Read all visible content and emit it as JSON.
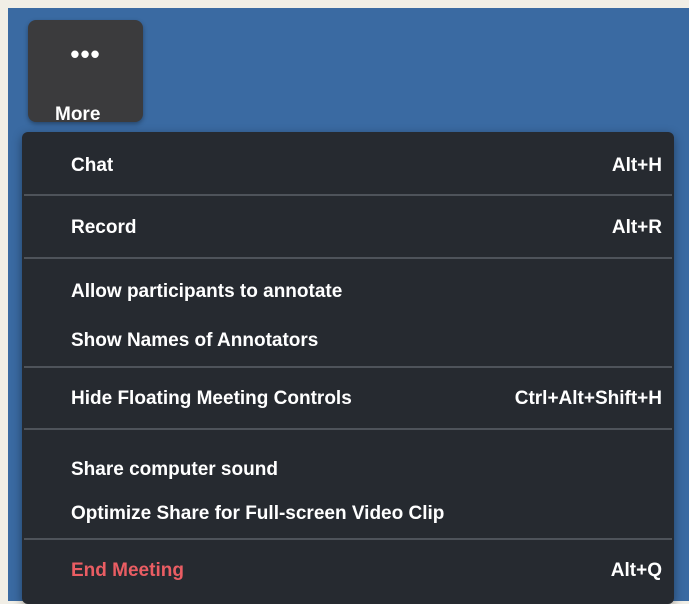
{
  "more_button": {
    "dots": "•••",
    "label": "More"
  },
  "menu": {
    "items": [
      {
        "label": "Chat",
        "shortcut": "Alt+H"
      },
      {
        "label": "Record",
        "shortcut": "Alt+R"
      },
      {
        "label": "Allow participants to annotate",
        "shortcut": ""
      },
      {
        "label": "Show Names of Annotators",
        "shortcut": ""
      },
      {
        "label": "Hide Floating Meeting Controls",
        "shortcut": "Ctrl+Alt+Shift+H"
      },
      {
        "label": "Share computer sound",
        "shortcut": ""
      },
      {
        "label": "Optimize Share for Full-screen Video Clip",
        "shortcut": ""
      },
      {
        "label": "End Meeting",
        "shortcut": "Alt+Q"
      }
    ]
  },
  "colors": {
    "screen_background": "#3a6aa2",
    "menu_background": "#262a30",
    "danger_text": "#ea5d63"
  }
}
